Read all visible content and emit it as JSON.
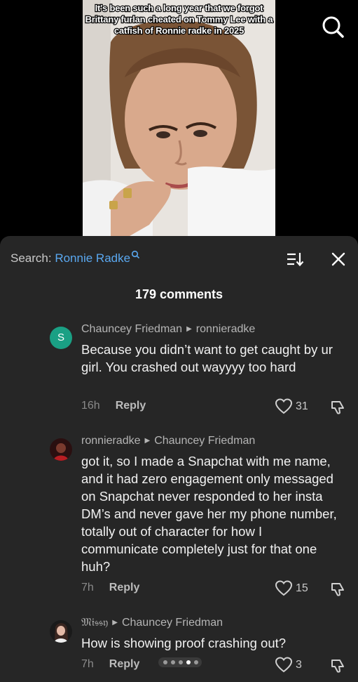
{
  "video": {
    "caption": "It's been such a long year that we forgot Brittany furlan cheated on Tommy Lee with a catfish of Ronnie radke in 2025"
  },
  "header": {
    "search_label": "Search:",
    "search_term": "Ronnie Radke",
    "comment_count": "179 comments"
  },
  "comments": [
    {
      "author": "Chauncey Friedman",
      "reply_to": "ronnieradke",
      "avatar_letter": "S",
      "text": "Because you didn’t want to get caught by ur girl. You crashed out wayyyy too hard",
      "time": "16h",
      "reply_label": "Reply",
      "likes": "31"
    },
    {
      "author": "ronnieradke",
      "reply_to": "Chauncey Friedman",
      "text": "got it, so I made a Snapchat with me name, and it had zero engagement only messaged on Snapchat never responded to her insta DM’s and never gave her my phone number, totally out of character for how I communicate completely just for that one huh?",
      "time": "7h",
      "reply_label": "Reply",
      "likes": "15"
    },
    {
      "author": "𝔐𝔦𝔰𝔰𝔶",
      "reply_to": "Chauncey Friedman",
      "text": "How is showing proof crashing out?",
      "time": "7h",
      "reply_label": "Reply",
      "likes": "3"
    }
  ],
  "pagination": {
    "total": 5,
    "active": 4
  }
}
